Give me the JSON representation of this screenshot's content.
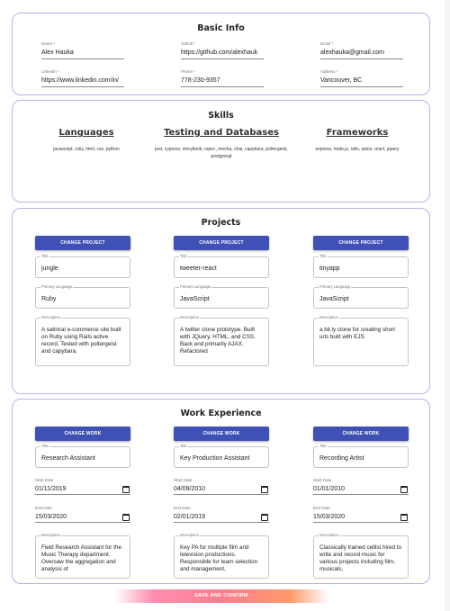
{
  "basic_info": {
    "title": "Basic Info",
    "fields": [
      {
        "label": "Name *",
        "value": "Alex Hauka"
      },
      {
        "label": "Github *",
        "value": "https://github.com/alexhauk"
      },
      {
        "label": "Email *",
        "value": "alexhauka@gmail.com"
      },
      {
        "label": "Linkedin *",
        "value": "https://www.linkedin.com/in/"
      },
      {
        "label": "Phone *",
        "value": "778-230-9357"
      },
      {
        "label": "Address *",
        "value": "Vancouver, BC"
      }
    ]
  },
  "skills": {
    "title": "Skills",
    "columns": [
      {
        "heading": "Languages",
        "items": "javascript, ruby, html, css, python"
      },
      {
        "heading": "Testing and Databases",
        "items": "jest, cypress, storybook, rspec, mocha, chai, capybara, poltergeist, postgresql"
      },
      {
        "heading": "Frameworks",
        "items": "express, node.js, rails, axios, react, jquery"
      }
    ]
  },
  "projects": {
    "title": "Projects",
    "button_label": "CHANGE PROJECT",
    "title_label": "Title",
    "language_label": "Primary Language",
    "description_label": "Description",
    "items": [
      {
        "title": "jungle",
        "language": "Ruby",
        "description": "A satirical e-commerce site built on Ruby using Rails active record. Tested with poltergeist and capybara."
      },
      {
        "title": "tweeter-react",
        "language": "JavaScript",
        "description": "A twitter clone prototype. Built with JQuery, HTML, and CSS. Back end primarily AJAX. Refactored"
      },
      {
        "title": "tinyapp",
        "language": "JavaScript",
        "description": "a bit.ly clone for creating short urls built with EJS."
      }
    ]
  },
  "work": {
    "title": "Work Experience",
    "button_label": "CHANGE WORK",
    "title_label": "Title",
    "start_label": "Start Date",
    "end_label": "End Date",
    "description_label": "Description",
    "items": [
      {
        "title": "Research Assistant",
        "start": "01/11/2019",
        "end": "15/03/2020",
        "description": "Field Research Assistant for the Music Therapy department. Oversaw the aggregation and analysis of"
      },
      {
        "title": "Key Production Assistant",
        "start": "04/09/2010",
        "end": "02/01/2019",
        "description": "Key PA for multiple film and television productions. Responsible for team selection and management,"
      },
      {
        "title": "Recording Artist",
        "start": "01/01/2010",
        "end": "15/03/2020",
        "description": "Classically trained cellist hired to write and record music for various projects including film, musicals,"
      }
    ]
  },
  "save_button": "SAVE AND CONFIRM",
  "colors": {
    "accent": "#3f51b5",
    "card_border": "#b9b3ea",
    "save_gradient": "#ff7d8e"
  }
}
